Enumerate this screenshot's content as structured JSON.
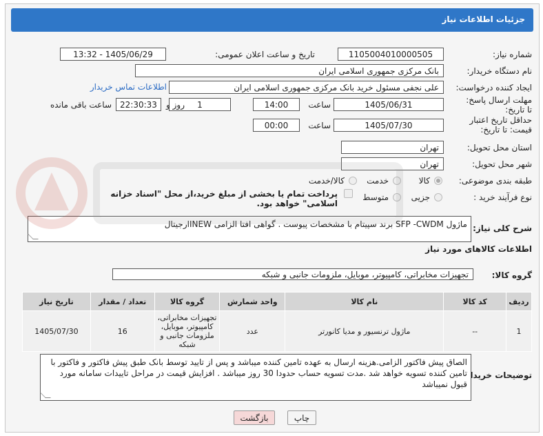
{
  "header": {
    "title": "جزئیات اطلاعات نیاز"
  },
  "fields": {
    "need_number_label": "شماره نیاز:",
    "need_number": "1105004010000505",
    "announce_label": "تاریخ و ساعت اعلان عمومی:",
    "announce_value": "1405/06/29 - 13:32",
    "buyer_org_label": "نام دستگاه خریدار:",
    "buyer_org": "بانک مرکزی جمهوری اسلامی ایران",
    "creator_label": "ایجاد کننده درخواست:",
    "creator": "علی  نجفی مسئول خرید بانک مرکزی جمهوری اسلامی ایران",
    "contact_link": "اطلاعات تماس خریدار",
    "deadline_label": "مهلت ارسال پاسخ: تا تاریخ:",
    "deadline_date": "1405/06/31",
    "time_label": "ساعت",
    "deadline_time": "14:00",
    "days_value": "1",
    "days_label": "روز و",
    "remaining_time": "22:30:33",
    "remaining_label": "ساعت باقی مانده",
    "validity_label": "حداقل تاریخ اعتبار قیمت: تا تاریخ:",
    "validity_date": "1405/07/30",
    "validity_time": "00:00",
    "province_label": "استان محل تحویل:",
    "province": "تهران",
    "city_label": "شهر محل تحویل:",
    "city": "تهران",
    "category_label": "طبقه بندی موضوعی:",
    "category_options": [
      "کالا",
      "خدمت",
      "کالا/خدمت"
    ],
    "process_label": "نوع فرآیند خرید :",
    "process_options": [
      "جزیی",
      "متوسط"
    ],
    "payment_note": "پرداخت تمام یا بخشی از مبلغ خرید،از محل \"اسناد خزانه اسلامی\" خواهد بود."
  },
  "summary": {
    "label": "شرح کلی نیاز:",
    "text": "ماژول SFP -CWDM برند سپیتام با مشخصات پیوست . گواهی افتا الزامی INEWارجیتال"
  },
  "goods": {
    "section_title": "اطلاعات کالاهای مورد نیاز",
    "group_label": "گروه کالا:",
    "group_value": "تجهیزات مخابراتی، کامپیوتر، موبایل، ملزومات جانبی و شبکه"
  },
  "table": {
    "headers": [
      "ردیف",
      "کد کالا",
      "نام کالا",
      "واحد شمارش",
      "گروه کالا",
      "تعداد / مقدار",
      "تاریخ نیاز"
    ],
    "rows": [
      [
        "1",
        "--",
        "ماژول ترنسیور و مدیا کانورتر",
        "عدد",
        "تجهیزات مخابراتی، کامپیوتر، موبایل، ملزومات جانبی و شبکه",
        "16",
        "1405/07/30"
      ]
    ]
  },
  "buyer_notes": {
    "label": "توضیحات خریدار:",
    "text": "الصاق پیش فاکتور الزامی.هزینه ارسال به عهده تامین کننده میباشد و پس از تایید توسط بانک طبق پیش فاکتور و فاکتور با تامین کننده تسویه خواهد شد .مدت تسویه حساب حدودا 30 روز میباشد . افزایش قیمت در مراحل تاییدات سامانه مورد قبول نمیباشد"
  },
  "buttons": {
    "print": "چاپ",
    "back": "بازگشت"
  },
  "colors": {
    "header": "#2f77c8",
    "link": "#2a6bc4",
    "back_button": "#f6d8d8"
  }
}
